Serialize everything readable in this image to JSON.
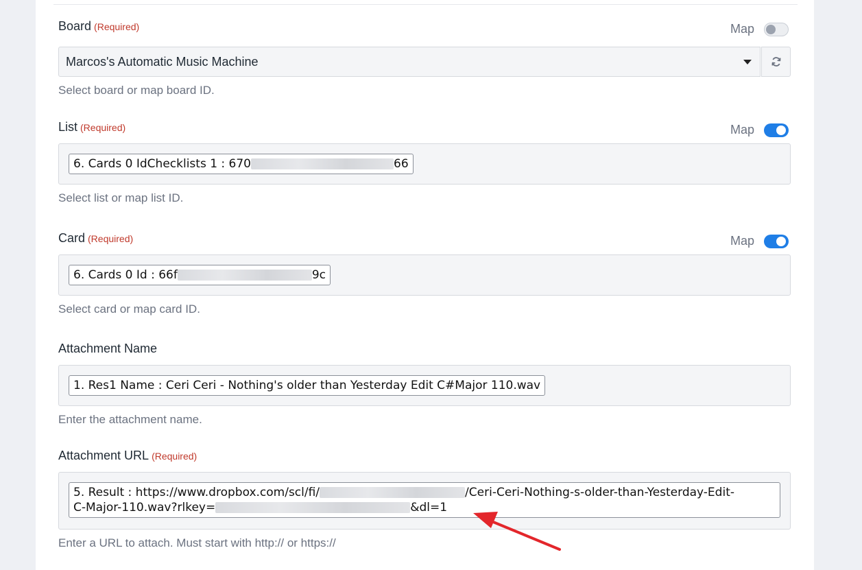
{
  "fields": {
    "board": {
      "label": "Board",
      "required": "(Required)",
      "map_label": "Map",
      "map_on": false,
      "value": "Marcos's Automatic Music Machine",
      "help": "Select board or map board ID."
    },
    "list": {
      "label": "List",
      "required": "(Required)",
      "map_label": "Map",
      "map_on": true,
      "pill_prefix": "6. Cards 0 IdChecklists 1 : 670",
      "pill_suffix": "66",
      "help": "Select list or map list ID."
    },
    "card": {
      "label": "Card",
      "required": "(Required)",
      "map_label": "Map",
      "map_on": true,
      "pill_prefix": "6. Cards 0 Id : 66f",
      "pill_suffix": "9c",
      "help": "Select card or map card ID."
    },
    "attachment_name": {
      "label": "Attachment Name",
      "pill": "1. Res1 Name : Ceri Ceri - Nothing's older than Yesterday Edit C#Major 110.wav",
      "help": "Enter the attachment name."
    },
    "attachment_url": {
      "label": "Attachment URL",
      "required": "(Required)",
      "pill_part1": "5. Result : https://www.dropbox.com/scl/fi/",
      "pill_part2": "/Ceri-Ceri-Nothing-s-older-than-Yesterday-Edit-",
      "pill_part3": "C-Major-110.wav?rlkey=",
      "pill_part4": "&dl=1",
      "help": "Enter a URL to attach. Must start with http:// or https://"
    }
  },
  "icons": {
    "refresh": "refresh-icon",
    "dropdown": "chevron-down-icon",
    "annotation": "red-arrow"
  },
  "colors": {
    "required": "#c0392b",
    "toggle_on": "#1f7ee6",
    "arrow": "#e3262b"
  }
}
